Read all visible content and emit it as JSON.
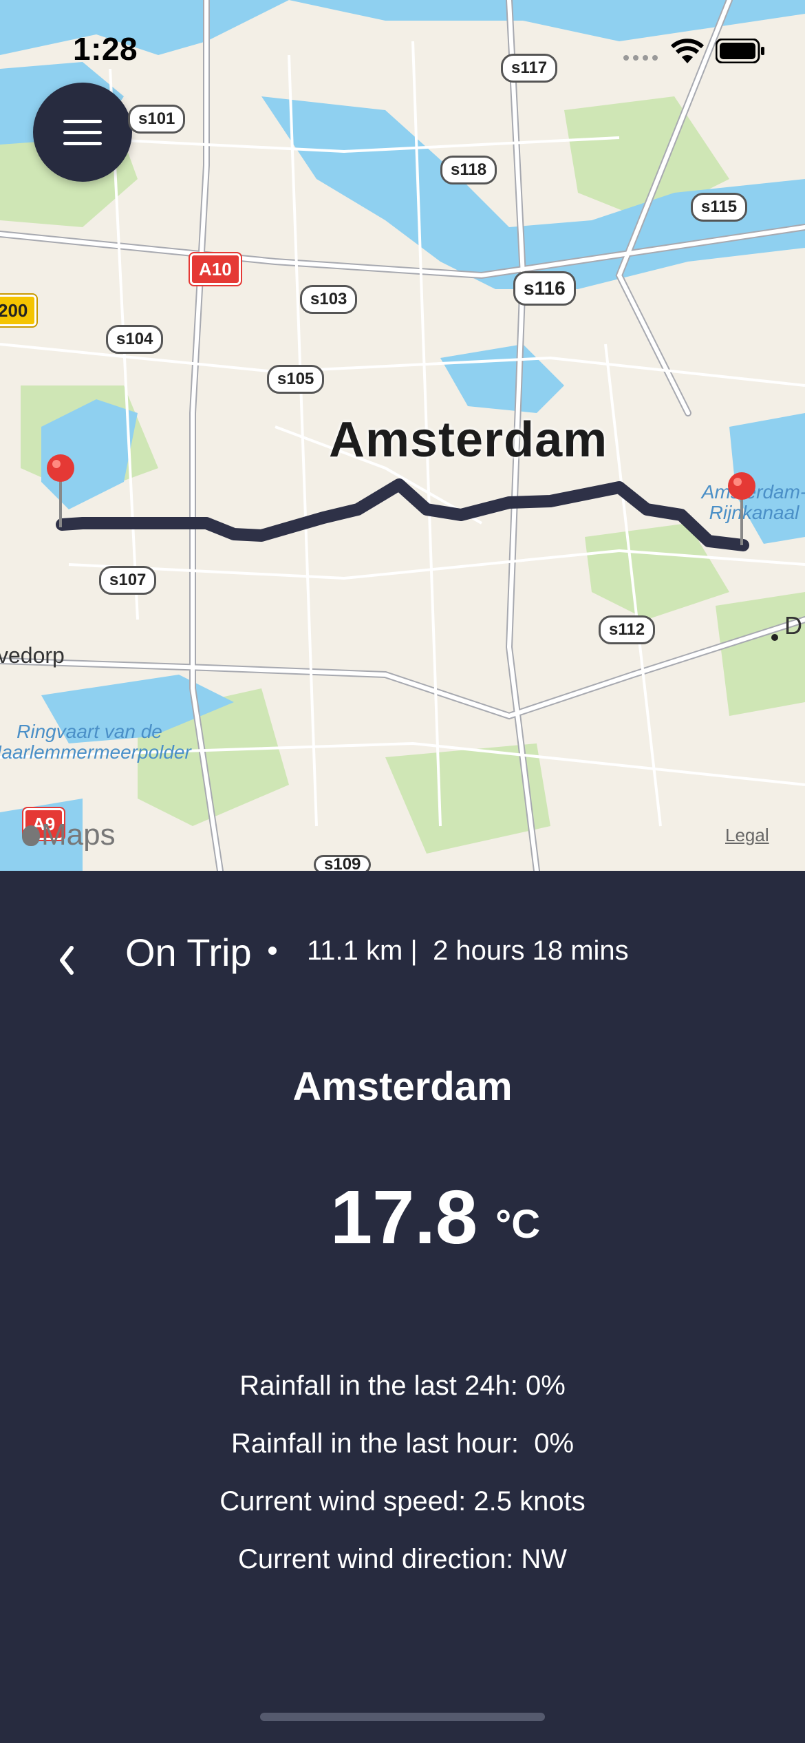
{
  "status_bar": {
    "time": "1:28"
  },
  "map": {
    "city_label": "Amsterdam",
    "shields": [
      "s117",
      "s101",
      "s118",
      "s115",
      "s116",
      "s103",
      "s104",
      "s105",
      "s107",
      "s112",
      "s109"
    ],
    "highways": [
      "A10",
      "A9",
      "200"
    ],
    "place_labels": [
      "vedorp",
      "D"
    ],
    "water_labels": [
      "Ringvaart van de Haarlemmermeerpolder",
      "Amsterdam-Rijnkanaal"
    ],
    "attribution": "Maps",
    "legal": "Legal",
    "colors": {
      "water": "#8fd0f0",
      "land": "#f3efe6",
      "park": "#cfe6b5",
      "route": "#2e3147",
      "pin": "#e53935"
    }
  },
  "trip": {
    "title": "On Trip",
    "distance": "11.1 km |",
    "duration": "2 hours 18 mins"
  },
  "weather": {
    "place": "Amsterdam",
    "temperature": "17.8",
    "unit": "°C",
    "rain_24h": "Rainfall in the last 24h: 0%",
    "rain_hour": "Rainfall in the last hour:  0%",
    "wind_speed": "Current wind speed: 2.5 knots",
    "wind_direction": "Current wind direction: NW"
  },
  "icons": [
    "menu-icon",
    "back-chevron-icon",
    "wifi-icon",
    "battery-icon",
    "cellular-icon",
    "map-pin-icon"
  ]
}
